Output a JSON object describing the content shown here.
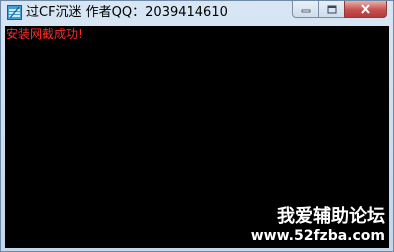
{
  "window": {
    "title": "过CF沉迷 作者QQ：2039414610"
  },
  "console": {
    "line": "安装网截成功!"
  },
  "watermark": {
    "title": "我爱辅助论坛",
    "url": "www.52fzba.com"
  },
  "colors": {
    "console_bg": "#000000",
    "console_text": "#ff2b2b",
    "close_button": "#c75050"
  },
  "icons": [
    "app-icon",
    "minimize-icon",
    "maximize-icon",
    "close-icon"
  ]
}
